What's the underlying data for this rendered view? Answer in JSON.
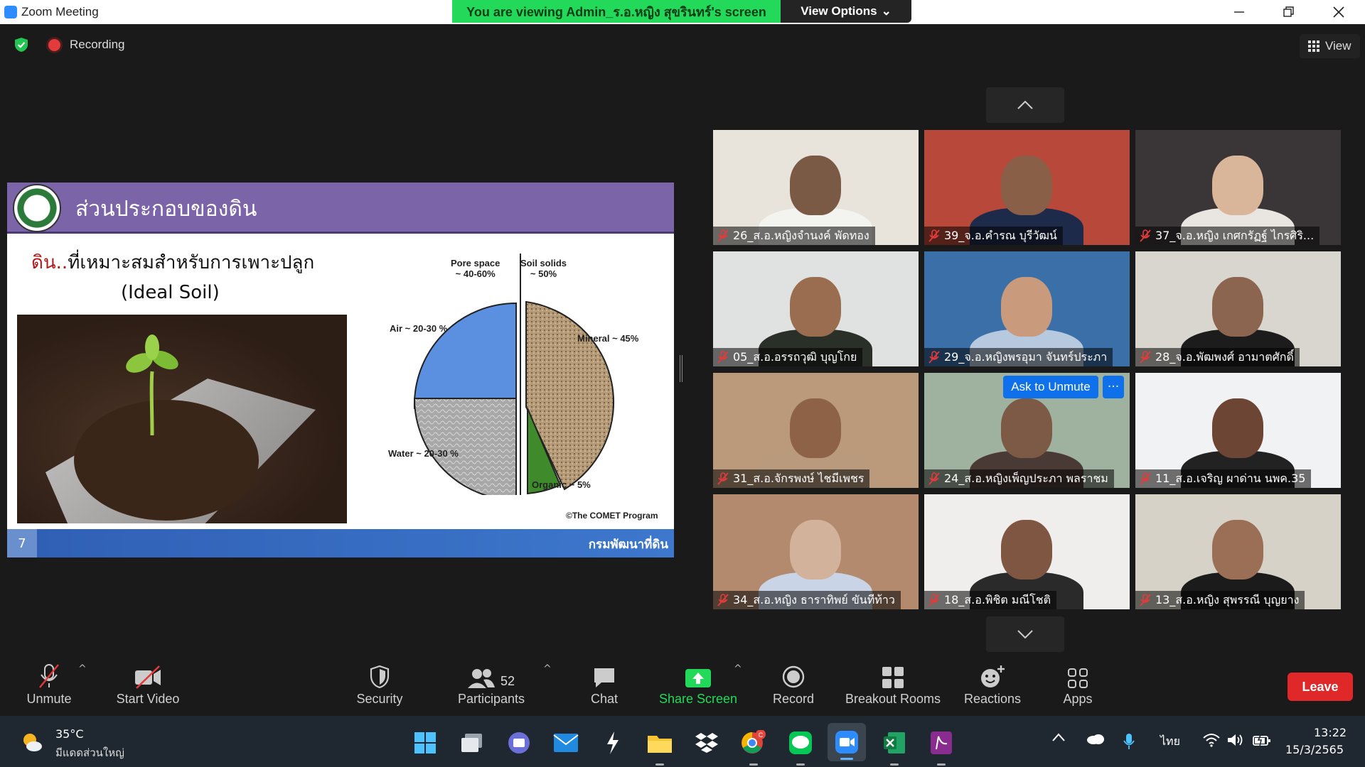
{
  "window": {
    "title": "Zoom Meeting",
    "viewing_banner": "You are viewing Admin_ร.อ.หญิง สุขรินทร์'s screen",
    "view_options_label": "View Options"
  },
  "status": {
    "recording_label": "Recording",
    "view_label": "View"
  },
  "slide": {
    "title": "ส่วนประกอบของดิน",
    "subtitle_red": "ดิน..",
    "subtitle_rest": "ที่เหมาะสมสำหรับการเพาะปลูก",
    "subtitle_en": "(Ideal Soil)",
    "pie_labels": {
      "pore_space": "Pore space",
      "pore_space_pct": "~ 40-60%",
      "soil_solids": "Soil solids",
      "soil_solids_pct": "~ 50%",
      "air": "Air ~ 20-30 %",
      "mineral": "Mineral ~ 45%",
      "water": "Water ~ 20-30 %",
      "organic": "Organic ~ 5%"
    },
    "credit": "©The COMET Program",
    "page_number": "7",
    "department": "กรมพัฒนาที่ดิน"
  },
  "gallery": {
    "ask_to_unmute": "Ask to Unmute",
    "more": "···",
    "participants": [
      {
        "name": "26_ส.อ.หญิงจำนงค์ พัดทอง",
        "bg": "#e8e4dc",
        "skin": "#7a5a45",
        "shirt": "#f3f3f0"
      },
      {
        "name": "39_จ.อ.คำรณ บุรีวัฒน์",
        "bg": "#b8493a",
        "skin": "#8a5f47",
        "shirt": "#1d2a4a"
      },
      {
        "name": "37_จ.อ.หญิง เกศกรัฏฐ์ ไกรศิริ...",
        "bg": "#3a3537",
        "skin": "#d9b59a",
        "shirt": "#e9e6e2"
      },
      {
        "name": "05_ส.อ.อรรถวุฒิ บุญโกย",
        "bg": "#dfe2e0",
        "skin": "#9a6d50",
        "shirt": "#2a2f28"
      },
      {
        "name": "29_จ.อ.หญิงพรอุมา จันทร์ประภา",
        "bg": "#3a6fa8",
        "skin": "#c99a7b",
        "shirt": "#b7c9de"
      },
      {
        "name": "28_จ.อ.พัฒพงศ์ อามาตศักดิ์",
        "bg": "#d8d6cf",
        "skin": "#8b6550",
        "shirt": "#1c1c1c"
      },
      {
        "name": "31_ส.อ.จักรพงษ์ ไชมีเพชร",
        "bg": "#ba9a7a",
        "skin": "#8e6246",
        "shirt": "#b99a7c"
      },
      {
        "name": "24_ส.อ.หญิงเพ็ญประภา  พลราชม",
        "bg": "#9fb2a0",
        "skin": "#7d5a45",
        "shirt": "#4a3a35"
      },
      {
        "name": "11_ส.อ.เจริญ ผาด่าน นพค.35",
        "bg": "#f1f2f3",
        "skin": "#6d4535",
        "shirt": "#222"
      },
      {
        "name": "34_ส.อ.หญิง ธาราทิพย์ ขันทีท้าว",
        "bg": "#b48a6f",
        "skin": "#d3b29b",
        "shirt": "#c9d4e6"
      },
      {
        "name": "18_ส.อ.พิชิต มณีโชติ",
        "bg": "#efeeec",
        "skin": "#7f5642",
        "shirt": "#2a2a2a"
      },
      {
        "name": "13_ส.อ.หญิง สุพรรณี บุญยาง",
        "bg": "#d7d2c8",
        "skin": "#9b6f55",
        "shirt": "#1b1b1b"
      }
    ]
  },
  "toolbar": {
    "unmute": "Unmute",
    "start_video": "Start Video",
    "security": "Security",
    "participants": "Participants",
    "participant_count": "52",
    "chat": "Chat",
    "share_screen": "Share Screen",
    "record": "Record",
    "breakout_rooms": "Breakout Rooms",
    "reactions": "Reactions",
    "apps": "Apps",
    "leave": "Leave"
  },
  "taskbar": {
    "temperature": "35°C",
    "weather_desc": "มีแดดส่วนใหญ่",
    "language": "ไทย",
    "time": "13:22",
    "date": "15/3/2565",
    "chrome_badge": "C"
  },
  "colors": {
    "share_green": "#23d959",
    "leave_red": "#e02828",
    "accent_blue": "#0e71eb"
  }
}
